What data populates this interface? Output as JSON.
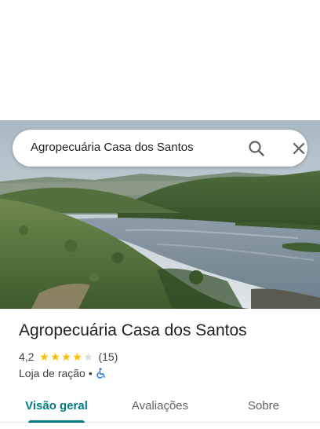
{
  "search": {
    "query": "Agropecuária Casa dos Santos",
    "search_icon": "search-icon",
    "close_icon": "close-icon"
  },
  "hero": {
    "image": "river-landscape-photo"
  },
  "place": {
    "title": "Agropecuária Casa dos Santos",
    "rating": "4,2",
    "rating_value": 4.2,
    "stars_max": 5,
    "review_count": "(15)",
    "category": "Loja de ração",
    "separator": "•",
    "accessibility_icon": "wheelchair-icon"
  },
  "tabs": [
    {
      "label": "Visão geral",
      "active": true
    },
    {
      "label": "Avaliações",
      "active": false
    },
    {
      "label": "Sobre",
      "active": false
    }
  ],
  "colors": {
    "accent": "#007b83",
    "star": "#fbbc04",
    "star_empty": "#dadce0",
    "accessibility": "#1a73e8"
  }
}
